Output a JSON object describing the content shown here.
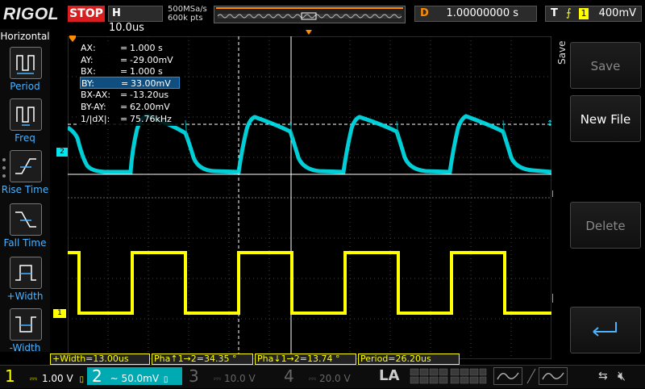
{
  "brand": "RIGOL",
  "run_state": "STOP",
  "horizontal": {
    "key": "H",
    "timebase": "10.0us",
    "sample_rate": "500MSa/s",
    "memory_depth": "600k pts"
  },
  "delay": {
    "key": "D",
    "value": "1.00000000 s"
  },
  "trigger": {
    "key": "T",
    "edge_symbol": "⨍",
    "source": "1",
    "level": "400mV"
  },
  "left_menu": {
    "title": "Horizontal",
    "items": [
      {
        "label": "Period",
        "icon": "period-icon"
      },
      {
        "label": "Freq",
        "icon": "freq-icon"
      },
      {
        "label": "Rise Time",
        "icon": "rise-time-icon"
      },
      {
        "label": "Fall Time",
        "icon": "fall-time-icon"
      },
      {
        "label": "+Width",
        "icon": "pos-width-icon"
      },
      {
        "label": "-Width",
        "icon": "neg-width-icon"
      }
    ]
  },
  "cursors": [
    {
      "key": "AX:",
      "value": "1.000 s"
    },
    {
      "key": "AY:",
      "value": "-29.00mV"
    },
    {
      "key": "BX:",
      "value": "1.000 s"
    },
    {
      "key": "BY:",
      "value": "33.00mV"
    },
    {
      "key": "BX-AX:",
      "value": "-13.20us"
    },
    {
      "key": "BY-AY:",
      "value": "62.00mV"
    },
    {
      "key": "1/|dX|:",
      "value": "75.76kHz"
    }
  ],
  "right_menu": {
    "section": "Save",
    "buttons": [
      "Save",
      "New File",
      "Delete"
    ]
  },
  "measurements": [
    "+Width=13.00us",
    "Pha↑1→2=34.35 °",
    "Pha↓1→2=13.74 °",
    "Period=26.20us"
  ],
  "channels": [
    {
      "num": "1",
      "coupling": "⎓",
      "scale": "1.00 V",
      "color": "#ffff00",
      "active": true
    },
    {
      "num": "2",
      "coupling": "~",
      "scale": "50.0mV",
      "color": "#00e5ee",
      "active": true
    },
    {
      "num": "3",
      "coupling": "⎓",
      "scale": "10.0 V",
      "color": "#777777",
      "active": false
    },
    {
      "num": "4",
      "coupling": "⎓",
      "scale": "20.0 V",
      "color": "#777777",
      "active": false
    }
  ],
  "la_label": "LA",
  "markers": {
    "ch1": "1",
    "ch2": "2",
    "trigger": "T"
  },
  "colors": {
    "ch1": "#ffff00",
    "ch2": "#00e5ee",
    "trigger": "#ff8c00",
    "stop": "#d81e1e",
    "accent": "#4ab3ff"
  }
}
